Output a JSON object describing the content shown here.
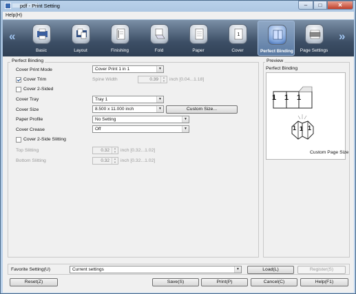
{
  "window": {
    "title": "pdf - Print Setting",
    "min": "–",
    "max": "□",
    "close": "✕"
  },
  "menu": {
    "help": "Help(H)"
  },
  "tabs": [
    {
      "label": "Basic",
      "icon": "basic-icon"
    },
    {
      "label": "Layout",
      "icon": "layout-icon"
    },
    {
      "label": "Finishing",
      "icon": "finishing-icon"
    },
    {
      "label": "Fold",
      "icon": "fold-icon"
    },
    {
      "label": "Paper",
      "icon": "paper-icon"
    },
    {
      "label": "Cover",
      "icon": "cover-icon"
    },
    {
      "label": "Perfect Binding",
      "icon": "perfect-binding-icon",
      "active": true
    },
    {
      "label": "Page Settings",
      "icon": "page-settings-icon"
    }
  ],
  "nav": {
    "prev": "«",
    "next": "»"
  },
  "perfect_binding": {
    "group_title": "Perfect Binding",
    "cover_print_mode": {
      "label": "Cover Print Mode",
      "value": "Cover Print 1 in 1"
    },
    "cover_trim": {
      "label": "Cover Trim",
      "checked": true
    },
    "spine_width": {
      "label": "Spine Width",
      "value": "0.39",
      "range": "inch [0.04...1.18]"
    },
    "cover_2_sided": {
      "label": "Cover 2-Sided",
      "checked": false
    },
    "cover_tray": {
      "label": "Cover Tray",
      "value": "Tray 1"
    },
    "cover_size": {
      "label": "Cover Size",
      "value": "8.500 x 11.000 inch",
      "button": "Custom Size..."
    },
    "paper_profile": {
      "label": "Paper Profile",
      "value": "No Setting"
    },
    "cover_crease": {
      "label": "Cover Crease",
      "value": "Off"
    },
    "cover_2_side_slitting": {
      "label": "Cover 2-Side Slitting",
      "checked": false
    },
    "top_slitting": {
      "label": "Top Slitting",
      "value": "0.32",
      "range": "inch [0.32...1.02]"
    },
    "bottom_slitting": {
      "label": "Bottom Slitting",
      "value": "0.32",
      "range": "inch [0.32...1.02]"
    }
  },
  "preview": {
    "group_title": "Preview",
    "subtitle": "Perfect Binding",
    "page_digits": [
      "1",
      "1",
      "1"
    ],
    "custom_label": "Custom Page Size"
  },
  "favorite": {
    "label": "Favorite Setting(U)",
    "value": "Current settings",
    "load": "Load(L)",
    "register": "Register(S)"
  },
  "footer": {
    "reset": "Reset(Z)",
    "save": "Save(S)",
    "print": "Print(P)",
    "cancel": "Cancel(C)",
    "help": "Help(F1)"
  }
}
